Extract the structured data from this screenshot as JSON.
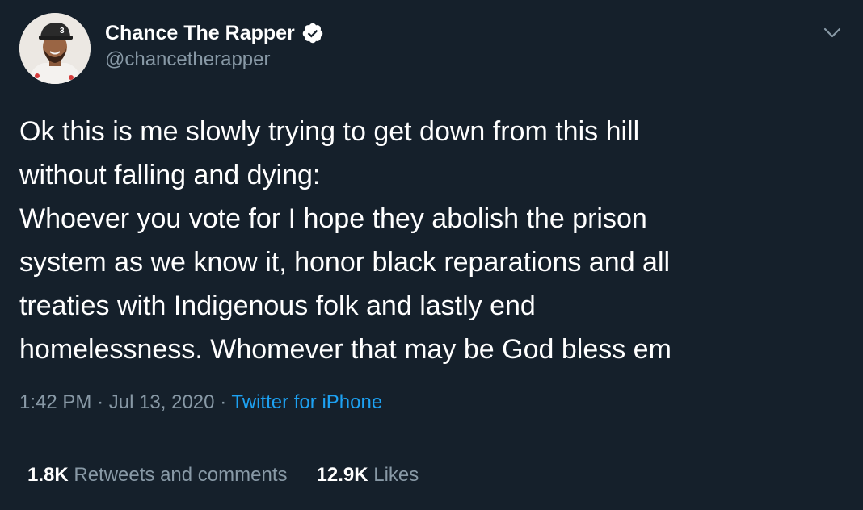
{
  "author": {
    "display_name": "Chance The Rapper",
    "handle": "@chancetherapper",
    "verified_icon": "verified-badge-icon",
    "avatar_icon": "avatar"
  },
  "tweet": {
    "lines": [
      "Ok this is me slowly trying to get down from this hill",
      "without falling and dying:",
      "Whoever you vote for I hope they abolish the prison",
      "system as we know it, honor black reparations and all",
      "treaties with Indigenous folk and lastly end",
      "homelessness. Whomever that may be God bless em"
    ]
  },
  "meta": {
    "time": "1:42 PM",
    "separator": "·",
    "date": "Jul 13, 2020",
    "source": "Twitter for iPhone"
  },
  "stats": {
    "retweets_count": "1.8K",
    "retweets_label": "Retweets and comments",
    "likes_count": "12.9K",
    "likes_label": "Likes"
  },
  "colors": {
    "background": "#15202b",
    "primary_text": "#ffffff",
    "secondary_text": "#8899a6",
    "link": "#1da1f2",
    "divider": "#38444d"
  },
  "icons": {
    "caret": "chevron-down-icon"
  }
}
